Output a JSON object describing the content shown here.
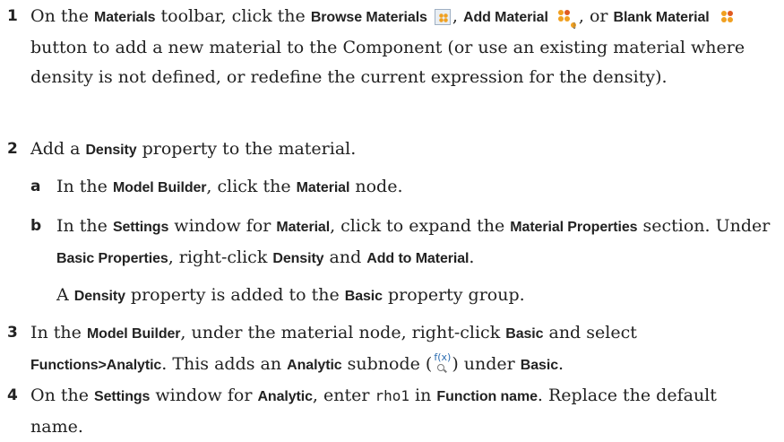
{
  "steps": {
    "s1": {
      "num": "1",
      "t1": "On the ",
      "b1": "Materials",
      "t2": " toolbar, click the ",
      "b2": "Browse Materials",
      "t3": ", ",
      "b3": "Add Material",
      "t4": ", or ",
      "b4": "Blank Material",
      "t5": " button to add a new material to the Component (or use an existing material where density is not defined, or redefine the current expression for the density).",
      "icons": [
        "browse-materials-icon",
        "add-material-icon",
        "blank-material-icon"
      ]
    },
    "s2": {
      "num": "2",
      "t1": "Add a ",
      "b1": "Density",
      "t2": " property to the material.",
      "a": {
        "letter": "a",
        "t1": "In the ",
        "b1": "Model Builder",
        "t2": ", click the ",
        "b2": "Material",
        "t3": " node."
      },
      "b": {
        "letter": "b",
        "t1": "In the ",
        "b1": "Settings",
        "t2": " window for ",
        "b2": "Material",
        "t3": ", click to expand the ",
        "b3": "Material Properties",
        "t4": " section. Under ",
        "b4": "Basic Properties",
        "t5": ", right-click ",
        "b5": "Density",
        "t6": " and ",
        "b6": "Add to Material",
        "t7": "."
      },
      "note": {
        "t1": "A ",
        "b1": "Density",
        "t2": " property is added to the ",
        "b2": "Basic",
        "t3": " property group."
      }
    },
    "s3": {
      "num": "3",
      "t1": "In the ",
      "b1": "Model Builder",
      "t2": ", under the material node, right-click ",
      "b2": "Basic",
      "t3": " and select ",
      "b3": "Functions>Analytic",
      "t4": ". This adds an ",
      "b4": "Analytic",
      "t5": " subnode (",
      "t6": ") under ",
      "b5": "Basic",
      "t7": ".",
      "icon": "analytic-function-icon"
    },
    "s4": {
      "num": "4",
      "t1": "On the ",
      "b1": "Settings",
      "t2": " window for ",
      "b2": "Analytic",
      "t3": ", enter ",
      "code": "rho1",
      "t4": " in ",
      "b3": "Function name",
      "t5": ". Replace the default name."
    }
  },
  "colors": {
    "text": "#222222",
    "icon_orange": "#f0a020",
    "icon_red": "#e05a20",
    "icon_blue": "#2b6cb0"
  }
}
